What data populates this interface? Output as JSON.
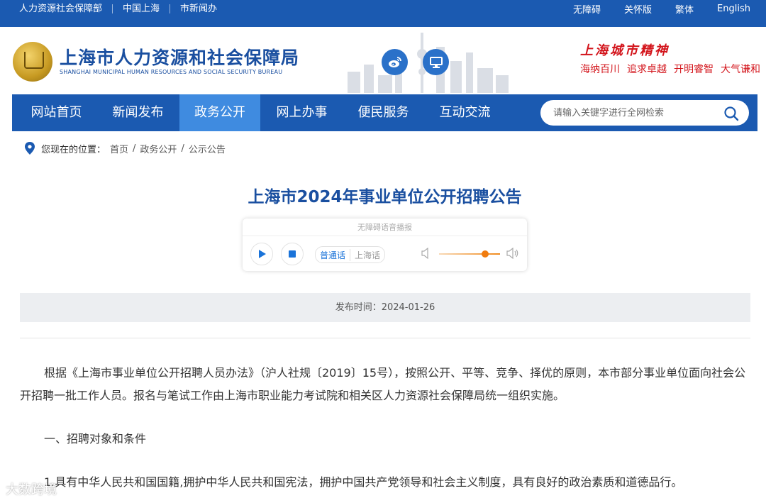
{
  "topbar": {
    "links_left": [
      "人力资源社会保障部",
      "中国上海",
      "市新闻办"
    ],
    "links_right": [
      "无障碍",
      "关怀版",
      "繁体",
      "English"
    ]
  },
  "header": {
    "title": "上海市人力资源和社会保障局",
    "subtitle": "SHANGHAI MUNICIPAL HUMAN RESOURCES AND SOCIAL SECURITY BUREAU",
    "spirit_title": "上海城市精神",
    "spirit_phrases": [
      "海纳百川",
      "追求卓越",
      "开明睿智",
      "大气谦和"
    ]
  },
  "nav": {
    "items": [
      "网站首页",
      "新闻发布",
      "政务公开",
      "网上办事",
      "便民服务",
      "互动交流"
    ],
    "active_index": 2,
    "search_placeholder": "请输入关键字进行全网检索"
  },
  "breadcrumb": {
    "label": "您现在的位置：",
    "items": [
      "首页",
      "政务公开",
      "公示公告"
    ]
  },
  "article": {
    "title": "上海市2024年事业单位公开招聘公告",
    "player": {
      "title": "无障碍语音播报",
      "dialect_active": "普通话",
      "dialect_other": "上海话",
      "volume_level": 0.75
    },
    "publish_time": "发布时间：2024-01-26",
    "paragraphs": [
      "根据《上海市事业单位公开招聘人员办法》（沪人社规〔2019〕15号），按照公开、平等、竞争、择优的原则，本市部分事业单位面向社会公开招聘一批工作人员。报名与笔试工作由上海市职业能力考试院和相关区人力资源社会保障局统一组织实施。",
      "一、招聘对象和条件",
      "1.具有中华人民共和国国籍,拥护中华人民共和国宪法，拥护中国共产党领导和社会主义制度，具有良好的政治素质和道德品行。"
    ]
  },
  "watermark": "大数跨境",
  "colors": {
    "primary": "#1b5ab1",
    "nav_active": "#3f8be0",
    "title_blue": "#1a4fa0",
    "spirit_red": "#d3141b"
  }
}
